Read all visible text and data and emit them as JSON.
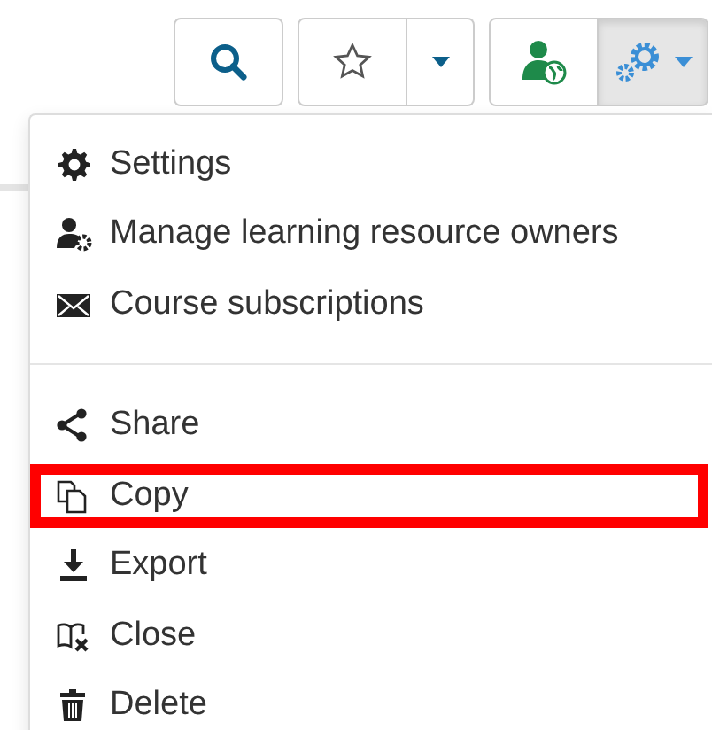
{
  "toolbar": {
    "gear_menu_expanded": true
  },
  "menu": {
    "groups": [
      [
        {
          "label": "Settings",
          "highlighted": false
        },
        {
          "label": "Manage learning resource owners",
          "highlighted": false
        },
        {
          "label": "Course subscriptions",
          "highlighted": false
        }
      ],
      [
        {
          "label": "Share",
          "highlighted": false
        },
        {
          "label": "Copy",
          "highlighted": true
        },
        {
          "label": "Export",
          "highlighted": false
        },
        {
          "label": "Close",
          "highlighted": false
        },
        {
          "label": "Delete",
          "highlighted": false
        }
      ]
    ]
  }
}
